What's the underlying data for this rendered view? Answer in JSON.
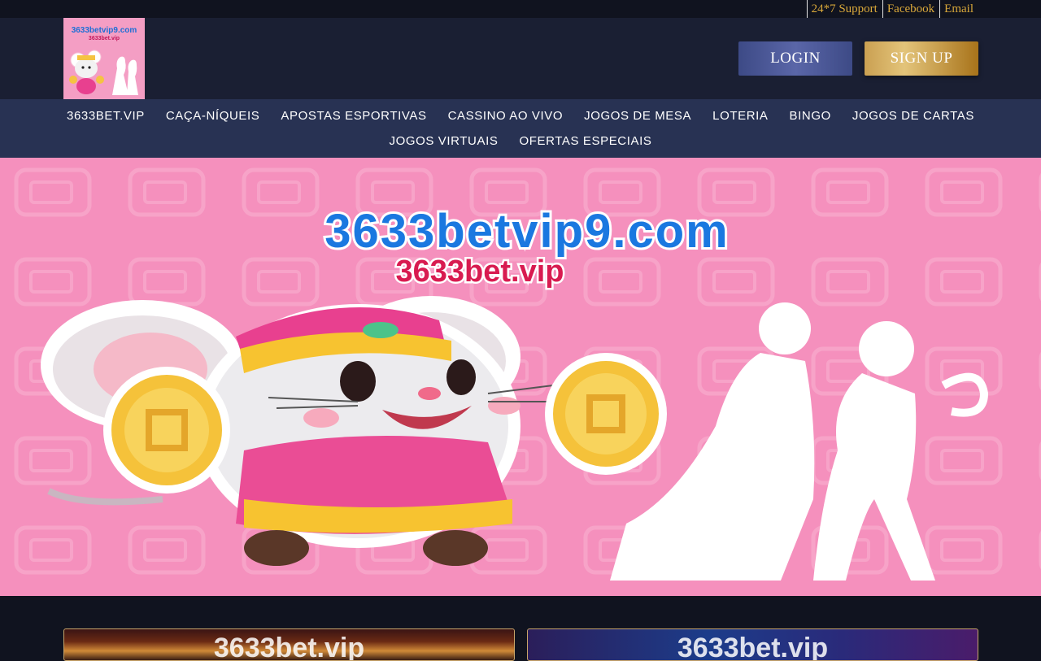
{
  "topbar": {
    "links": [
      "24*7 Support",
      "Facebook",
      "Email"
    ]
  },
  "header": {
    "logo": {
      "line1": "3633betvip9.com",
      "line2": "3633bet.vip"
    },
    "login_label": "LOGIN",
    "signup_label": "SIGN UP"
  },
  "nav": {
    "row1": [
      "3633BET.VIP",
      "CAÇA-NÍQUEIS",
      "APOSTAS ESPORTIVAS",
      "CASSINO AO VIVO",
      "JOGOS DE MESA",
      "LOTERIA",
      "BINGO",
      "JOGOS DE CARTAS"
    ],
    "row2": [
      "JOGOS VIRTUAIS",
      "OFERTAS ESPECIAIS"
    ]
  },
  "hero": {
    "line1": "3633betvip9.com",
    "line2": "3633bet.vip"
  },
  "cards": [
    {
      "text": "3633bet.vip"
    },
    {
      "text": "3633bet.vip"
    }
  ],
  "colors": {
    "background": "#10131f",
    "header": "#1a1f33",
    "nav": "#283253",
    "accent_gold": "#d9a83a",
    "hero_pink": "#f590bd"
  }
}
